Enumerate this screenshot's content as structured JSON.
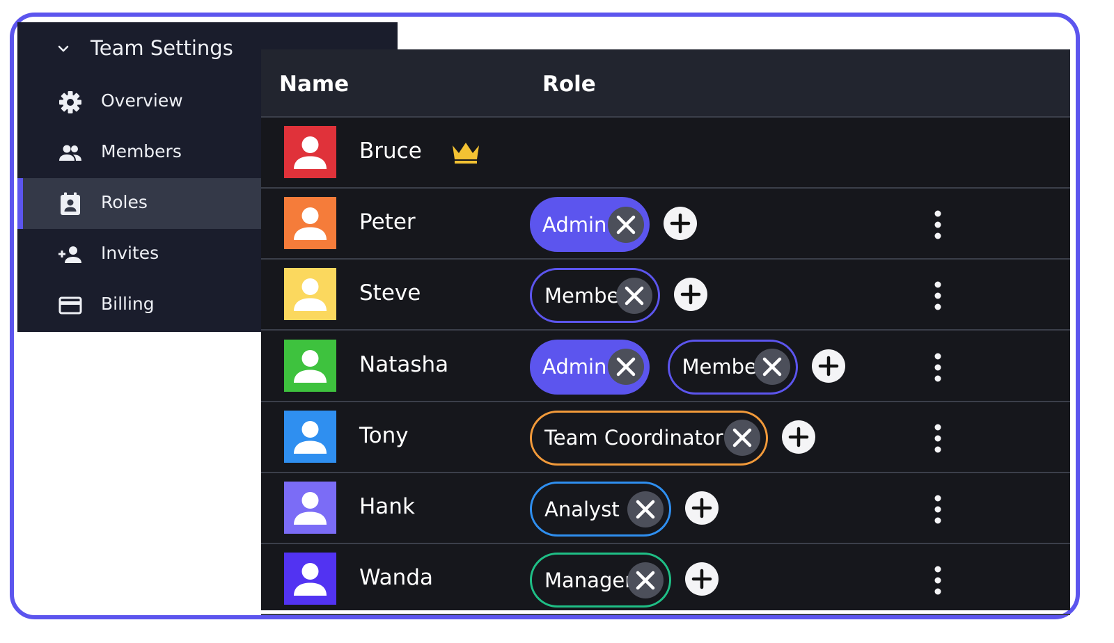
{
  "sidebar": {
    "title": "Team Settings",
    "items": [
      {
        "label": "Overview",
        "icon": "gear-icon"
      },
      {
        "label": "Members",
        "icon": "people-icon"
      },
      {
        "label": "Roles",
        "icon": "badge-icon",
        "active": true
      },
      {
        "label": "Invites",
        "icon": "person-add-icon"
      },
      {
        "label": "Billing",
        "icon": "credit-card-icon"
      }
    ]
  },
  "table": {
    "headers": {
      "name": "Name",
      "role": "Role"
    },
    "rows": [
      {
        "name": "Bruce",
        "avatar_color": "#e0323a",
        "owner": true,
        "roles": []
      },
      {
        "name": "Peter",
        "avatar_color": "#f57c3a",
        "roles": [
          {
            "label": "Admin",
            "style": "filled",
            "color": "#5c55ee"
          }
        ]
      },
      {
        "name": "Steve",
        "avatar_color": "#fbd85e",
        "roles": [
          {
            "label": "Member",
            "style": "outlined",
            "color": "#5c55ee"
          }
        ]
      },
      {
        "name": "Natasha",
        "avatar_color": "#3ec23e",
        "roles": [
          {
            "label": "Admin",
            "style": "filled",
            "color": "#5c55ee"
          },
          {
            "label": "Member",
            "style": "outlined",
            "color": "#5c55ee"
          }
        ]
      },
      {
        "name": "Tony",
        "avatar_color": "#2f8ff0",
        "roles": [
          {
            "label": "Team Coordinator",
            "style": "outlined",
            "color": "#f29a3a"
          }
        ]
      },
      {
        "name": "Hank",
        "avatar_color": "#7b6cf6",
        "roles": [
          {
            "label": "Analyst",
            "style": "outlined",
            "color": "#2f8ff0"
          }
        ]
      },
      {
        "name": "Wanda",
        "avatar_color": "#5233f2",
        "roles": [
          {
            "label": "Manager",
            "style": "outlined",
            "color": "#1fbf86"
          }
        ]
      }
    ]
  },
  "colors": {
    "accent": "#5c55ee",
    "crown": "#f3c233"
  }
}
